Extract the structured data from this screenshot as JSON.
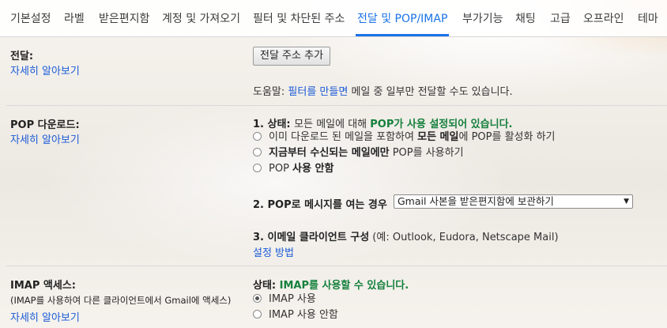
{
  "tabs": [
    "기본설정",
    "라벨",
    "받은편지함",
    "계정 및 가져오기",
    "필터 및 차단된 주소",
    "전달 및 POP/IMAP",
    "부가기능",
    "채팅",
    "고급",
    "오프라인",
    "테마"
  ],
  "forwarding": {
    "label": "전달:",
    "learn_more": "자세히 알아보기",
    "add_button": "전달 주소 추가",
    "tip_prefix": "도움말: ",
    "tip_link": "필터를 만들면",
    "tip_suffix": " 메일 중 일부만 전달할 수도 있습니다."
  },
  "pop": {
    "label": "POP 다운로드:",
    "learn_more": "자세히 알아보기",
    "status_prefix": "1. 상태: ",
    "status_mid": "모든 메일에 대해 ",
    "status_value": "POP가 사용 설정되어 있습니다.",
    "options": [
      {
        "pre": "이미 다운로드 된 메일을 포함하여 ",
        "bold": "모든 메일",
        "post": "에 POP를 활성화 하기",
        "selected": false
      },
      {
        "pre": "",
        "bold": "지금부터 수신되는 메일에만",
        "post": " POP를 사용하기",
        "selected": false
      },
      {
        "pre": "POP ",
        "bold": "사용 안함",
        "post": "",
        "selected": false
      }
    ],
    "access_label": "2. POP로 메시지를 여는 경우",
    "access_selected": "Gmail 사본을 받은편지함에 보관하기",
    "client_label": "3. 이메일 클라이언트 구성",
    "client_examples": " (예: Outlook, Eudora, Netscape Mail)",
    "setup_link": "설정 방법"
  },
  "imap": {
    "label": "IMAP 액세스:",
    "sublabel": "(IMAP를 사용하여 다른 클라이언트에서 Gmail에 액세스)",
    "learn_more": "자세히 알아보기",
    "status_prefix": "상태: ",
    "status_value": "IMAP를 사용할 수 있습니다.",
    "options": [
      {
        "label": "IMAP 사용",
        "selected": true
      },
      {
        "label": "IMAP 사용 안함",
        "selected": false
      }
    ]
  }
}
